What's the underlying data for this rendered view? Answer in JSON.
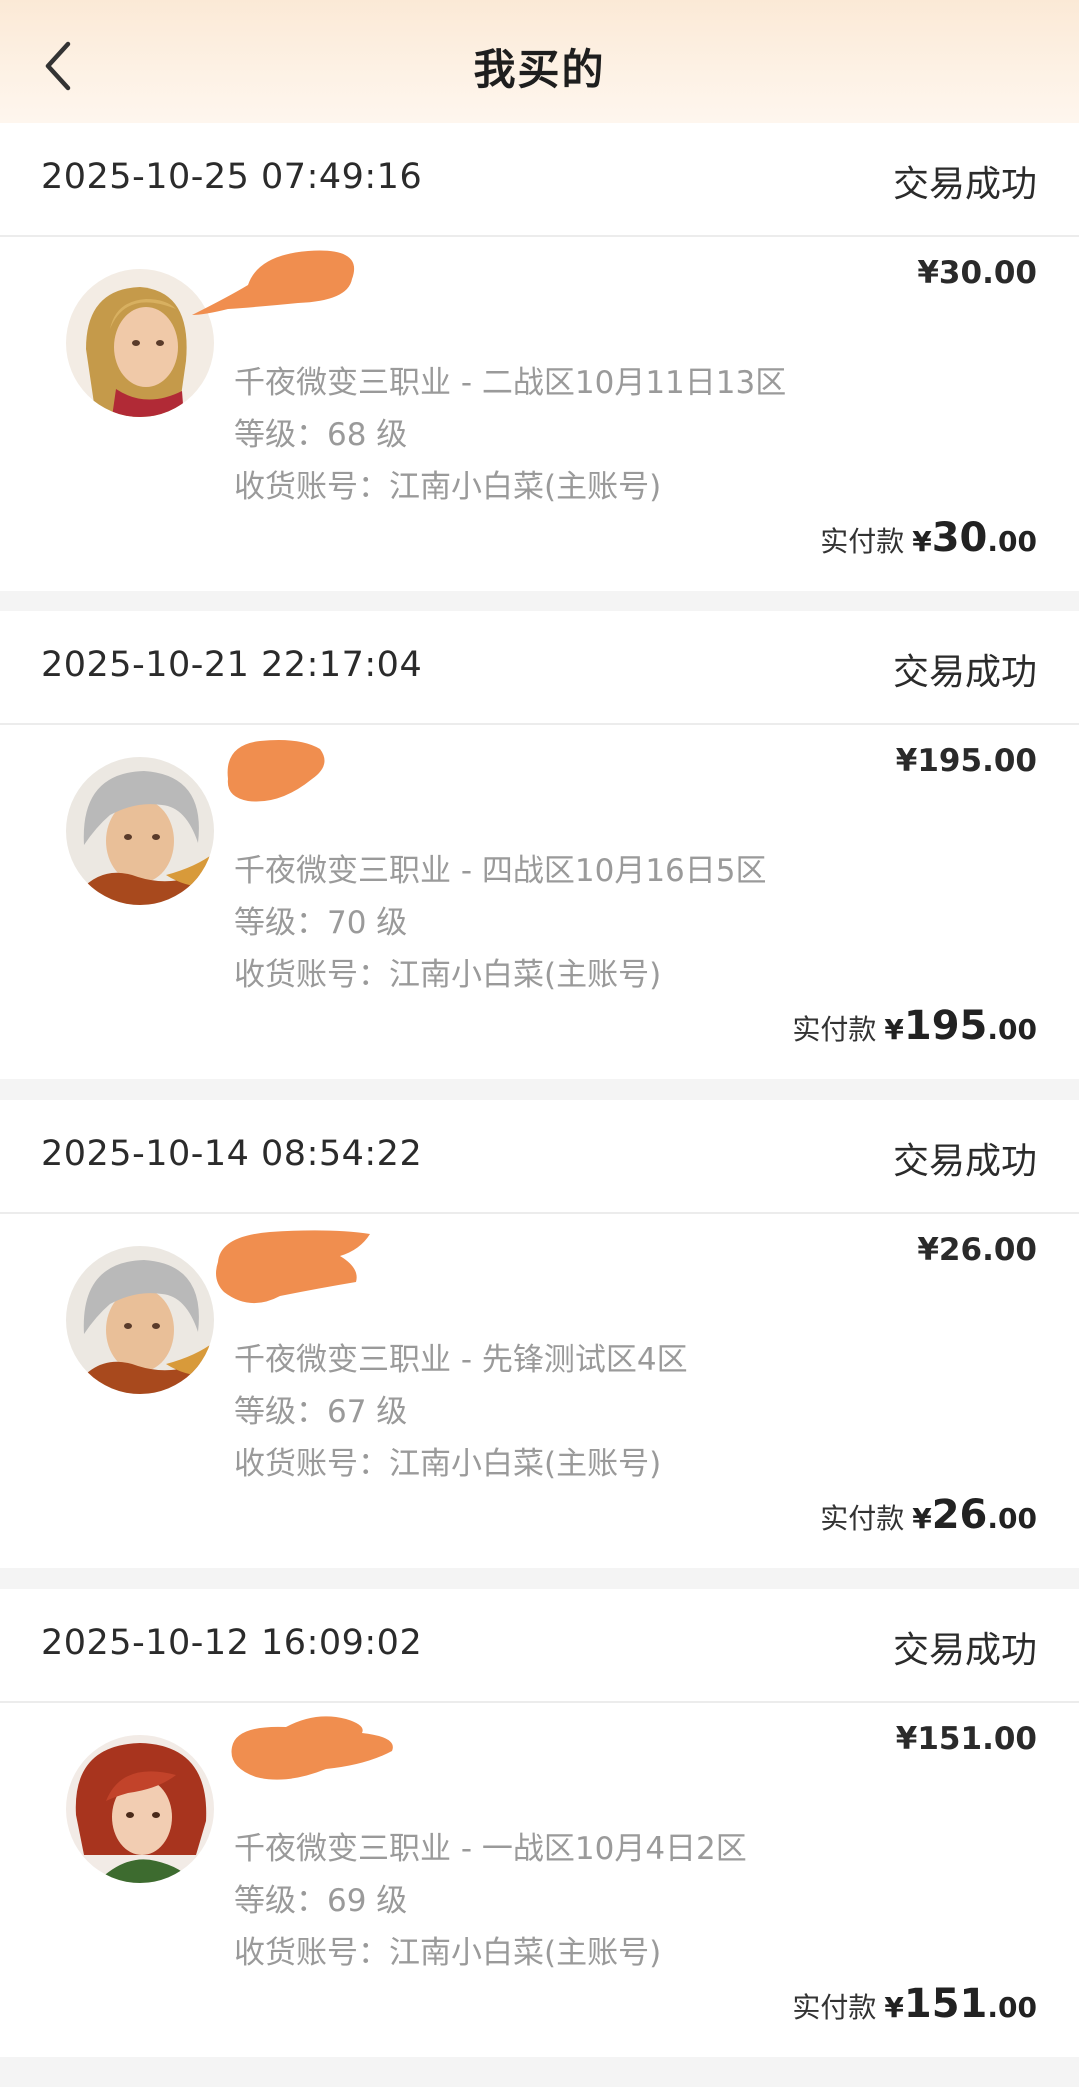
{
  "header": {
    "title": "我买的"
  },
  "orders": [
    {
      "time": "2025-10-25 07:49:16",
      "status": "交易成功",
      "price": "¥30.00",
      "server": "千夜微变三职业 - 二战区10月11日13区",
      "level": "等级：68 级",
      "account": "收货账号：江南小白菜(主账号)",
      "paid_label": "实付款",
      "paid_yen": "¥",
      "paid_int": "30",
      "paid_dec": ".00"
    },
    {
      "time": "2025-10-21 22:17:04",
      "status": "交易成功",
      "price": "¥195.00",
      "server": "千夜微变三职业 - 四战区10月16日5区",
      "level": "等级：70 级",
      "account": "收货账号：江南小白菜(主账号)",
      "paid_label": "实付款",
      "paid_yen": "¥",
      "paid_int": "195",
      "paid_dec": ".00"
    },
    {
      "time": "2025-10-14 08:54:22",
      "status": "交易成功",
      "price": "¥26.00",
      "server": "千夜微变三职业 - 先锋测试区4区",
      "level": "等级：67 级",
      "account": "收货账号：江南小白菜(主账号)",
      "paid_label": "实付款",
      "paid_yen": "¥",
      "paid_int": "26",
      "paid_dec": ".00"
    },
    {
      "time": "2025-10-12 16:09:02",
      "status": "交易成功",
      "price": "¥151.00",
      "server": "千夜微变三职业 - 一战区10月4日2区",
      "level": "等级：69 级",
      "account": "收货账号：江南小白菜(主账号)",
      "paid_label": "实付款",
      "paid_yen": "¥",
      "paid_int": "151",
      "paid_dec": ".00"
    }
  ],
  "colors": {
    "header_gradient_top": "#fbe9d6",
    "redaction": "#f08e4f",
    "secondary_text": "#9a9a9a",
    "page_bg": "#f4f4f4"
  },
  "icons": {
    "back": "chevron-left-icon",
    "avatars": [
      "blond-warrior-avatar",
      "silver-hair-warrior-avatar",
      "silver-hair-warrior-avatar",
      "red-hair-girl-avatar"
    ]
  }
}
